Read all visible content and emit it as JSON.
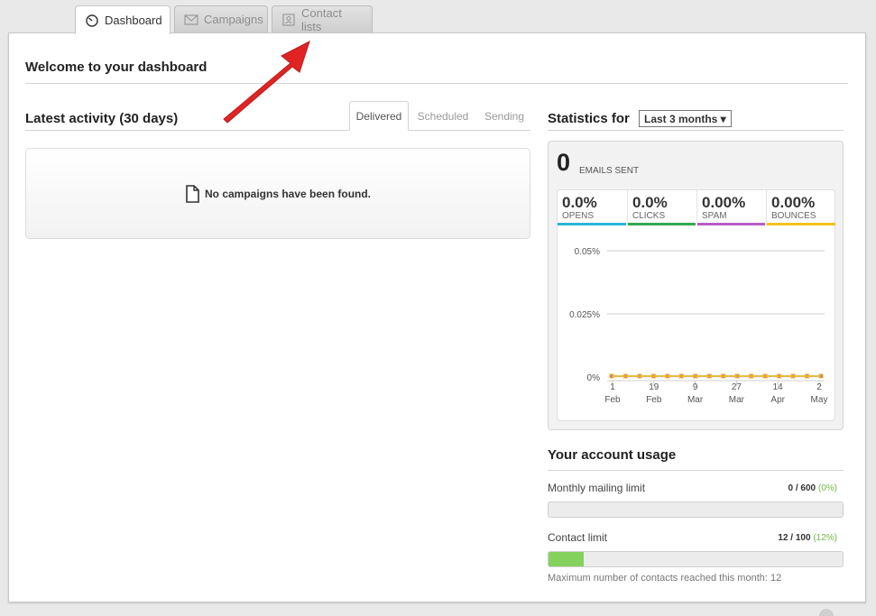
{
  "tabs": [
    {
      "label": "Dashboard",
      "icon": "gauge-icon",
      "active": true
    },
    {
      "label": "Campaigns",
      "icon": "envelope-icon",
      "active": false
    },
    {
      "label": "Contact lists",
      "icon": "address-book-icon",
      "active": false
    }
  ],
  "welcome": "Welcome to your dashboard",
  "activity": {
    "title": "Latest activity (30 days)",
    "tabs": [
      "Delivered",
      "Scheduled",
      "Sending"
    ],
    "active_tab": "Delivered",
    "empty_message": "No campaigns have been found.",
    "empty_icon": "document-icon"
  },
  "statistics": {
    "title": "Statistics for",
    "period": "Last 3 months ▾",
    "emails_sent": "0",
    "emails_sent_label": "EMAILS SENT",
    "metrics": [
      {
        "value": "0.0%",
        "label": "OPENS",
        "color": "#27b7d9"
      },
      {
        "value": "0.0%",
        "label": "CLICKS",
        "color": "#34a853"
      },
      {
        "value": "0.00%",
        "label": "SPAM",
        "color": "#b85cc8"
      },
      {
        "value": "0.00%",
        "label": "BOUNCES",
        "color": "#f2c21b"
      }
    ]
  },
  "chart_data": {
    "type": "line",
    "y_ticks": [
      "0.05%",
      "0.025%",
      "0%"
    ],
    "ylim": [
      0,
      0.05
    ],
    "x_labels": [
      {
        "day": "1",
        "month": "Feb"
      },
      {
        "day": "19",
        "month": "Feb"
      },
      {
        "day": "9",
        "month": "Mar"
      },
      {
        "day": "27",
        "month": "Mar"
      },
      {
        "day": "14",
        "month": "Apr"
      },
      {
        "day": "2",
        "month": "May"
      }
    ],
    "series": [
      {
        "color": "#b85cc8",
        "values": [
          0,
          0,
          0,
          0,
          0,
          0,
          0,
          0,
          0,
          0,
          0,
          0,
          0,
          0,
          0,
          0
        ]
      },
      {
        "color": "#f2c21b",
        "values": [
          0,
          0,
          0,
          0,
          0,
          0,
          0,
          0,
          0,
          0,
          0,
          0,
          0,
          0,
          0,
          0
        ]
      }
    ]
  },
  "usage": {
    "title": "Your account usage",
    "items": [
      {
        "label": "Monthly mailing limit",
        "used": "0",
        "total": " / 600",
        "pct": " (0%)",
        "fraction": 0.0
      },
      {
        "label": "Contact limit",
        "used": "12",
        "total": " / 100",
        "pct": " (12%)",
        "fraction": 0.12
      }
    ],
    "note": "Maximum number of contacts reached this month: 12"
  },
  "colors": {
    "accent_arrow": "#e02424",
    "progress_fill": "#84d25d"
  }
}
